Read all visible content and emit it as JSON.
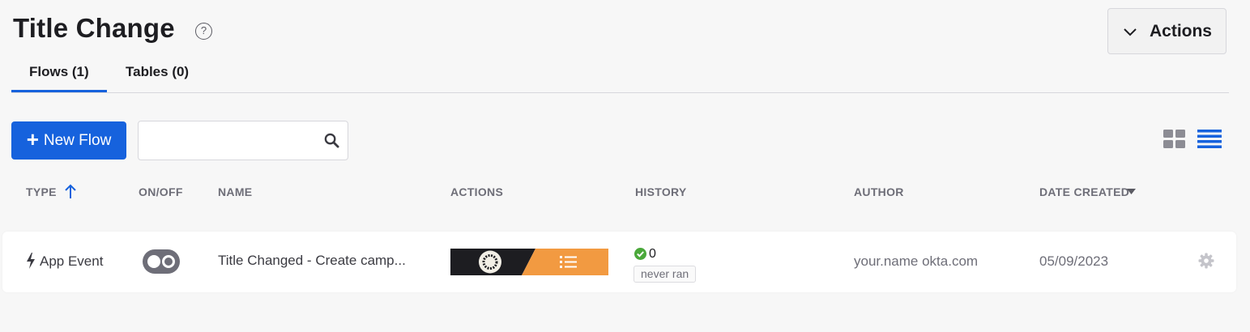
{
  "header": {
    "title": "Title Change",
    "help_glyph": "?",
    "actions_label": "Actions"
  },
  "tabs": [
    {
      "label": "Flows (1)",
      "active": true
    },
    {
      "label": "Tables (0)",
      "active": false
    }
  ],
  "toolbar": {
    "new_flow_label": "New Flow",
    "search_value": "",
    "search_placeholder": "",
    "view_mode": "list"
  },
  "columns": {
    "type": "TYPE",
    "on_off": "ON/OFF",
    "name": "NAME",
    "actions": "ACTIONS",
    "history": "HISTORY",
    "author": "AUTHOR",
    "date_created": "DATE CREATED"
  },
  "rows": [
    {
      "type": "App Event",
      "enabled": false,
      "name": "Title Changed - Create camp...",
      "history_count": "0",
      "history_status": "never ran",
      "author": "your.name okta.com",
      "date_created": "05/09/2023"
    }
  ],
  "colors": {
    "accent": "#1662dd",
    "success": "#4aa83a",
    "strip_dark": "#1d1d21",
    "strip_orange": "#f29a41"
  },
  "icons": [
    "help-icon",
    "chevron-down-icon",
    "plus-icon",
    "search-icon",
    "grid-view-icon",
    "list-view-icon",
    "sort-up-icon",
    "sort-down-icon",
    "bolt-icon",
    "check-circle-icon",
    "gear-icon",
    "app-logo-icon",
    "list-icon"
  ]
}
